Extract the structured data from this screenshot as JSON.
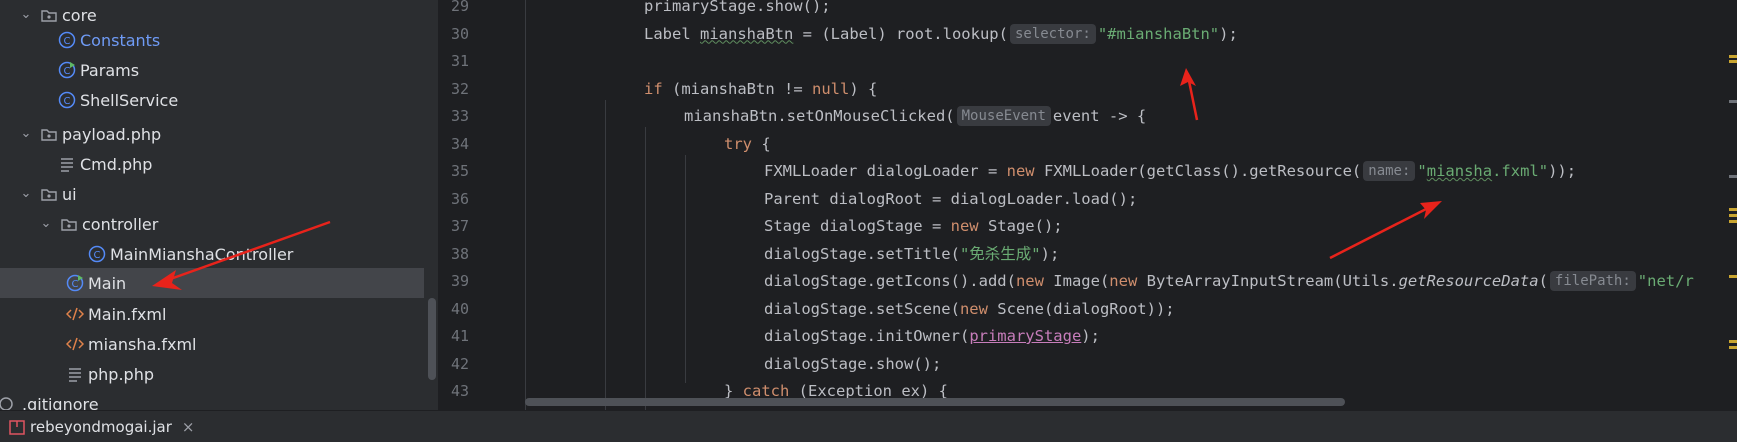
{
  "project_tree": {
    "items": [
      {
        "label": "core",
        "type": "folder",
        "depth": 0,
        "expanded": true
      },
      {
        "label": "Constants",
        "type": "class",
        "depth": 1,
        "highlight": true
      },
      {
        "label": "Params",
        "type": "class-run",
        "depth": 1
      },
      {
        "label": "ShellService",
        "type": "class",
        "depth": 1
      },
      {
        "label": "payload.php",
        "type": "folder",
        "depth": 0,
        "expanded": true
      },
      {
        "label": "Cmd.php",
        "type": "file",
        "depth": 1
      },
      {
        "label": "ui",
        "type": "folder",
        "depth": 0,
        "expanded": true
      },
      {
        "label": "controller",
        "type": "folder",
        "depth": 1,
        "expanded": true
      },
      {
        "label": "MainMianshaController",
        "type": "class",
        "depth": 2
      },
      {
        "label": "Main",
        "type": "class-run",
        "depth": 1,
        "selected": true
      },
      {
        "label": "Main.fxml",
        "type": "xml",
        "depth": 1
      },
      {
        "label": "miansha.fxml",
        "type": "xml",
        "depth": 1
      },
      {
        "label": "php.php",
        "type": "file",
        "depth": 1
      },
      {
        "label": ".gitignore",
        "type": "file",
        "depth": -1
      }
    ]
  },
  "editor": {
    "line_numbers": [
      "29",
      "30",
      "31",
      "32",
      "33",
      "34",
      "35",
      "36",
      "37",
      "38",
      "39",
      "40",
      "41",
      "42",
      "43"
    ],
    "hints": {
      "selector": "selector:",
      "mouse_event": "MouseEvent",
      "name": "name:",
      "file_path": "filePath:"
    },
    "lines": {
      "l29": "primaryStage.show();",
      "l30_a": "Label ",
      "l30_b": "mianshaBtn",
      "l30_c": " = (Label) root.lookup(",
      "l30_str": "\"#mianshaBtn\"",
      "l30_end": ");",
      "l32_kw": "if",
      "l32_a": " (mianshaBtn != ",
      "l32_null": "null",
      "l32_b": ") {",
      "l33_a": "mianshaBtn.setOnMouseClicked(",
      "l33_b": "event -> {",
      "l34_kw": "try",
      "l34_b": " {",
      "l35_a": "FXMLLoader dialogLoader = ",
      "l35_new": "new",
      "l35_b": " FXMLLoader(getClass().getResource(",
      "l35_str_q1": "\"",
      "l35_str_sq": "miansha",
      "l35_str_rest": ".fxml\"",
      "l35_end": "));",
      "l36": "Parent dialogRoot = dialogLoader.load();",
      "l37_a": "Stage dialogStage = ",
      "l37_new": "new",
      "l37_b": " Stage();",
      "l38_a": "dialogStage.setTitle(",
      "l38_str": "\"免杀生成\"",
      "l38_end": ");",
      "l39_a": "dialogStage.getIcons().add(",
      "l39_new1": "new",
      "l39_b": " Image(",
      "l39_new2": "new",
      "l39_c": " ByteArrayInputStream(Utils.",
      "l39_fn": "getResourceData",
      "l39_d": "(",
      "l39_str": "\"net/r",
      "l40_a": "dialogStage.setScene(",
      "l40_new": "new",
      "l40_b": " Scene(dialogRoot));",
      "l41_a": "dialogStage.initOwner(",
      "l41_field": "primaryStage",
      "l41_end": ");",
      "l42": "dialogStage.show();",
      "l43_a": "} ",
      "l43_kw": "catch",
      "l43_b": " (Exception ex) {"
    }
  },
  "bottom_bar": {
    "tab_label": "rebeyondmogai.jar",
    "close_glyph": "×"
  },
  "colors": {
    "keyword": "#cf8e6d",
    "string": "#6aab73",
    "field": "#c77dbb",
    "annotation_arrow": "#e8231b"
  }
}
